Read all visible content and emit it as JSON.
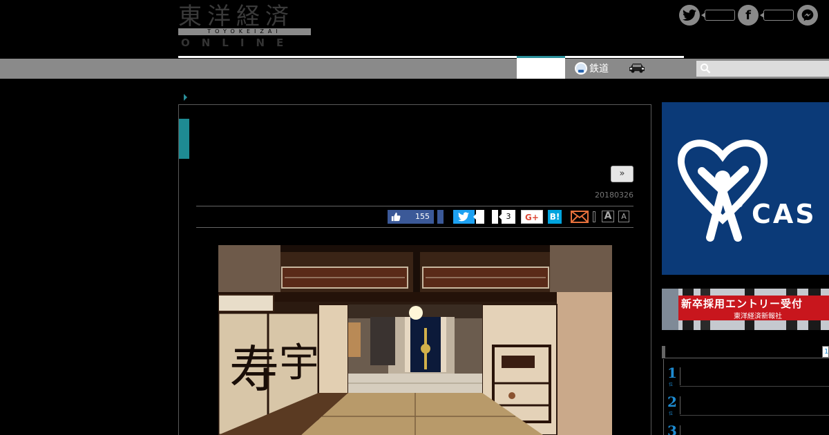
{
  "header": {
    "logo_kanji": "東洋経済",
    "logo_band": "TOYOKEIZAI",
    "logo_online": "ONLINE"
  },
  "social": {
    "twitter_glyph": "t",
    "facebook_glyph": "f",
    "twitter_icon": "twitter-icon",
    "facebook_icon": "facebook-icon",
    "messenger_icon": "messenger-icon"
  },
  "nav": {
    "rail_label": "鉄道",
    "rail_icon": "train-icon",
    "car_icon": "car-icon",
    "search_icon": "search-icon"
  },
  "article": {
    "next_label": "»",
    "date": "20180326",
    "share": {
      "facebook_like_count": "155",
      "pocket_count": "3",
      "gplus_label": "G+",
      "hatena_label": "B!",
      "font_large": "A",
      "font_small": "A"
    }
  },
  "sidebar": {
    "ad_brand": "CAS",
    "ad_registered": "®",
    "recruit_title": "新卒採用エントリー受付",
    "recruit_company": "東洋経済新報社",
    "ranking_tab": "1",
    "ranking": [
      {
        "rank": "1",
        "sub": "位"
      },
      {
        "rank": "2",
        "sub": "位"
      },
      {
        "rank": "3",
        "sub": "位"
      }
    ]
  },
  "colors": {
    "accent_teal": "#1e8b93",
    "nav_gray": "#8a8a8a",
    "facebook": "#3b5998",
    "twitter": "#1da1f2",
    "hatena": "#00a4de",
    "ranking_blue": "#1e8bd1",
    "ad_navy": "#0b3a78"
  }
}
